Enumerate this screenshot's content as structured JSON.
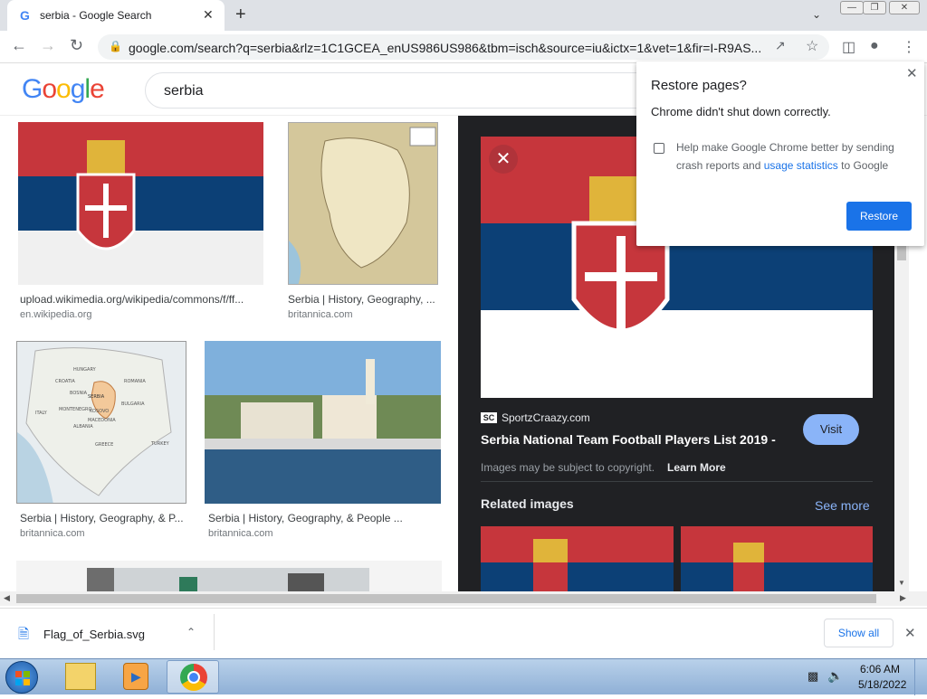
{
  "browser": {
    "tab_icon": "G",
    "tab_title": "serbia - Google Search",
    "tab_close": "✕",
    "new_tab": "+",
    "url": "google.com/search?q=serbia&rlz=1C1GCEA_enUS986US986&tbm=isch&source=iu&ictx=1&vet=1&fir=I-R9AS..."
  },
  "google": {
    "logo_letters": [
      "G",
      "o",
      "o",
      "g",
      "l",
      "e"
    ],
    "logo_colors": [
      "#4285f4",
      "#ea4335",
      "#fbbc05",
      "#4285f4",
      "#34a853",
      "#ea4335"
    ],
    "query": "serbia"
  },
  "results": [
    {
      "caption": "upload.wikimedia.org/wikipedia/commons/f/ff...",
      "source": "en.wikipedia.org"
    },
    {
      "caption": "Serbia | History, Geography, ...",
      "source": "britannica.com"
    },
    {
      "caption": "Serbia | History, Geography, & P...",
      "source": "britannica.com"
    },
    {
      "caption": "Serbia | History, Geography, & People ...",
      "source": "britannica.com"
    }
  ],
  "map_labels": [
    "HUNGARY",
    "CROATIA",
    "BOSNIA",
    "SERBIA",
    "ROMANIA",
    "ITALY",
    "MONTENEGRO",
    "KOSOVO",
    "BULGARIA",
    "ALBANIA",
    "MACEDONIA",
    "GREECE",
    "TURKEY"
  ],
  "panel": {
    "site_logo": "SC",
    "site": "SportzCraazy.com",
    "title": "Serbia National Team Football Players List 2019 -",
    "visit": "Visit",
    "copyright": "Images may be subject to copyright.",
    "learn_more": "Learn More",
    "related": "Related images",
    "see_more": "See more"
  },
  "restore": {
    "title": "Restore pages?",
    "message": "Chrome didn't shut down correctly.",
    "checkbox_text_1": "Help make Google Chrome better by sending",
    "checkbox_text_2": "crash reports and",
    "checkbox_link": "usage statistics",
    "checkbox_text_3": "to Google",
    "button": "Restore"
  },
  "download": {
    "filename": "Flag_of_Serbia.svg",
    "show_all": "Show all"
  },
  "taskbar": {
    "time": "6:06 AM",
    "date": "5/18/2022"
  }
}
